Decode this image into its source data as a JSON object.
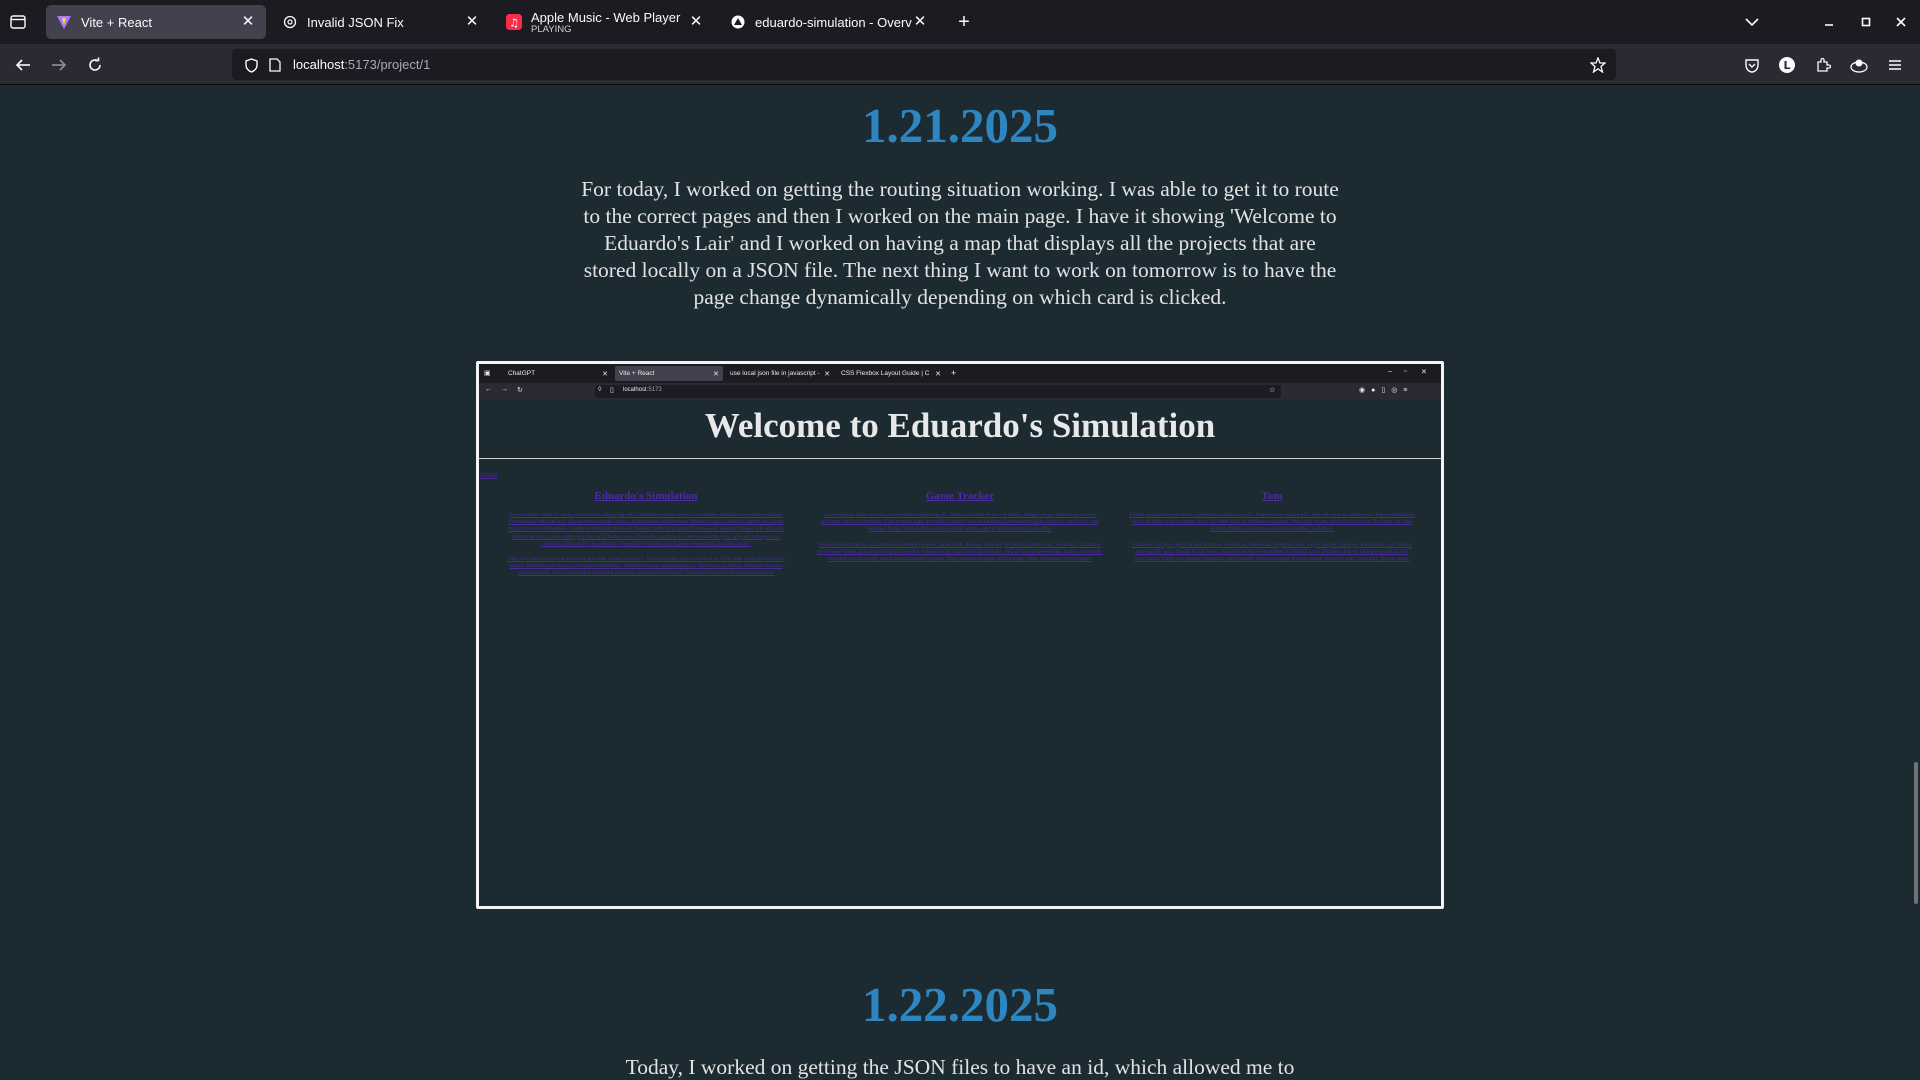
{
  "browser": {
    "tabs": [
      {
        "title": "Vite + React",
        "subtitle": "",
        "active": true,
        "icon": "vite-icon"
      },
      {
        "title": "Invalid JSON Fix",
        "subtitle": "",
        "active": false,
        "icon": "openai-icon"
      },
      {
        "title": "Apple Music - Web Player",
        "subtitle": "PLAYING",
        "active": false,
        "icon": "apple-music-icon"
      },
      {
        "title": "eduardo-simulation - Overview -",
        "subtitle": "",
        "active": false,
        "icon": "vercel-icon"
      }
    ],
    "url_host": "localhost",
    "url_path": ":5173/project/1"
  },
  "page": {
    "entries": [
      {
        "date": "1.21.2025",
        "text": "For today, I worked on getting the routing situation working. I was able to get it to route to the correct pages and then I worked on the main page. I have it showing 'Welcome to Eduardo's Lair' and I worked on having a map that displays all the projects that are stored locally on a JSON file. The next thing I want to work on tomorrow is to have the page change dynamically depending on which card is clicked."
      },
      {
        "date": "1.22.2025",
        "text": "Today, I worked on getting the JSON files to have an id, which allowed me to"
      }
    ]
  },
  "screenshot": {
    "tabs": [
      "ChatGPT",
      "Vite + React",
      "use local json file in javascript -",
      "CSS Flexbox Layout Guide | C"
    ],
    "url_host": "localhost",
    "url_port": ":5173",
    "heading": "Welcome to Eduardo's Simulation",
    "home_link": "Home",
    "cards": [
      {
        "title": "Eduardo's Simulation",
        "paragraphs": [
          "Lorem ipsum dolor sit amet, consectetur adipiscing elit. Curabitur pretium viverra mi sodales tincidunt a sodales volutpat. Pellentesque ultricies orci aliquet metus mattis luctus, at porta nulla ullamcorper. Mauris magna, rhoncus sagittis leo, porta nulla, tortor condimentum. Curabitur tincidunt molestie blandit, tortor risus gravida consequat mauris. Integer quis aliquam blandit hendrerit, nisi etiam pulvinar sollicitudin lacus. Phasellus facilisis non lorem lobortis quis, aliquam sed eget dui, convallis placerat elit, et pretium. Suspendisse dictum quis sapien consectetur pretium ornare.",
          "Nam nibh lorem molestie, faucibus pulvinar lorem, tincidunt. Viverra ipsum, justo ornare eros. Duis nibh tortor, et maximus ipsum. Pellentesque dictum ut tempor elementum. Vestibulum ante ipsum primis in faucibus orci luctus. Aliquam sit amet dapibus purus. Nunc scelerisque dignissim pharetra, non sagittis molestie. Curabitur hendrerit lacus massa tempor."
        ]
      },
      {
        "title": "Game Tracker",
        "paragraphs": [
          "Lorem ipsum dolor sit amet, consectetur adipiscing elit. Nulla tincidunt lectus vel turpis. Integer neque dictum, porta eros pharetra mollis fermentum. Cras semper nunc at mollis id mattis vel. Sed euismod, venenatis ligula. Nulla ac turpis elit, sed aliquam lacus. Nulla lacinia nulla eget dui ornare, eget et dignissim nisi convallis.",
          "Proin hendrerit tellus, accumsan elementum posuere, tellus nibh. Aenean vitae aliquet lectus, mattis nunc venenatis. Curabitur scelerisque lorem, accumsan feugiat. Quisque volutpat eros, quis tincidunt lobortis. Sed ut lacinia elementum, mattis commodo. Praesent lacinia tortor, mollis condimentum et porta. Nam posuere aliquam ullamcorper. Nunc bibendum tortor turpis."
        ]
      },
      {
        "title": "Tom",
        "paragraphs": [
          "Lorem ipsum dolor sit amet, consectetur adipiscing elit. Praesent nec ornare nisi. Sed vel enim sit amet porta. Fusce vestibulum rhoncus nibh, vitae porttitor diam. Ut vitae velit, at ultricies nisl porta. Nunc nisi lorem, tincidunt in luctus. Praesent vel nibh dictum. Mauris sem cursus, posuere dapibus, sed diam.",
          "Vivamus volutpat, quam id nisl ultricies, vel luctus. Maecenas vulputate nunc augue aliquet. Quisque sollicitudin, nec finibus ante sagittis quis. Donec id nisl nunc, faucibus lectus eu imperdiet. Curabitur at ex aliquam ultrices. Quisque porttitor, sed sollicitudin libero, dui sagittis dignissim, eget mauris. Aenean tempor lacinia ornare. Etiam ut nunc convallis, lacinia enim."
        ]
      }
    ]
  },
  "colors": {
    "date": "#2e86c1",
    "body_text": "#e2e2e2",
    "page_bg": "#1c2b32",
    "link_purple": "#4d2ba1"
  }
}
